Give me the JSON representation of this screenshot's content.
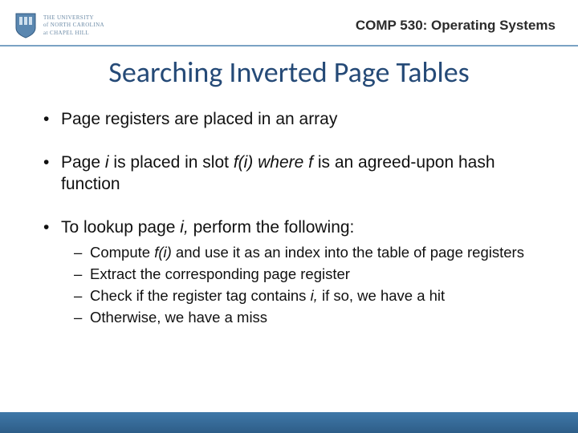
{
  "header": {
    "logo_lines": [
      "THE UNIVERSITY",
      "of NORTH CAROLINA",
      "at CHAPEL HILL"
    ],
    "course_label": "COMP 530: Operating Systems"
  },
  "title": "Searching Inverted Page Tables",
  "bullets": [
    {
      "pre": "Page registers are placed in an array",
      "it1": "",
      "mid": "",
      "it2": "",
      "post": ""
    },
    {
      "pre": "Page ",
      "it1": "i",
      "mid": " is placed in slot ",
      "it2": "f(i) where f",
      "post": " is an agreed-upon hash function"
    },
    {
      "pre": "To lookup page ",
      "it1": "i,",
      "mid": " perform the following:",
      "it2": "",
      "post": ""
    }
  ],
  "subbullets": [
    {
      "pre": "Compute ",
      "it1": "f(i)",
      "mid": " and use it as an index into the table of page registers",
      "it2": "",
      "post": ""
    },
    {
      "pre": "Extract the corresponding page register",
      "it1": "",
      "mid": "",
      "it2": "",
      "post": ""
    },
    {
      "pre": "Check if the register tag contains ",
      "it1": "i,",
      "mid": " if so, we have a hit",
      "it2": "",
      "post": ""
    },
    {
      "pre": "Otherwise, we have a miss",
      "it1": "",
      "mid": "",
      "it2": "",
      "post": ""
    }
  ],
  "colors": {
    "accent": "#254a77",
    "rule": "#7aa2c4",
    "footer": "#3f78a8"
  }
}
